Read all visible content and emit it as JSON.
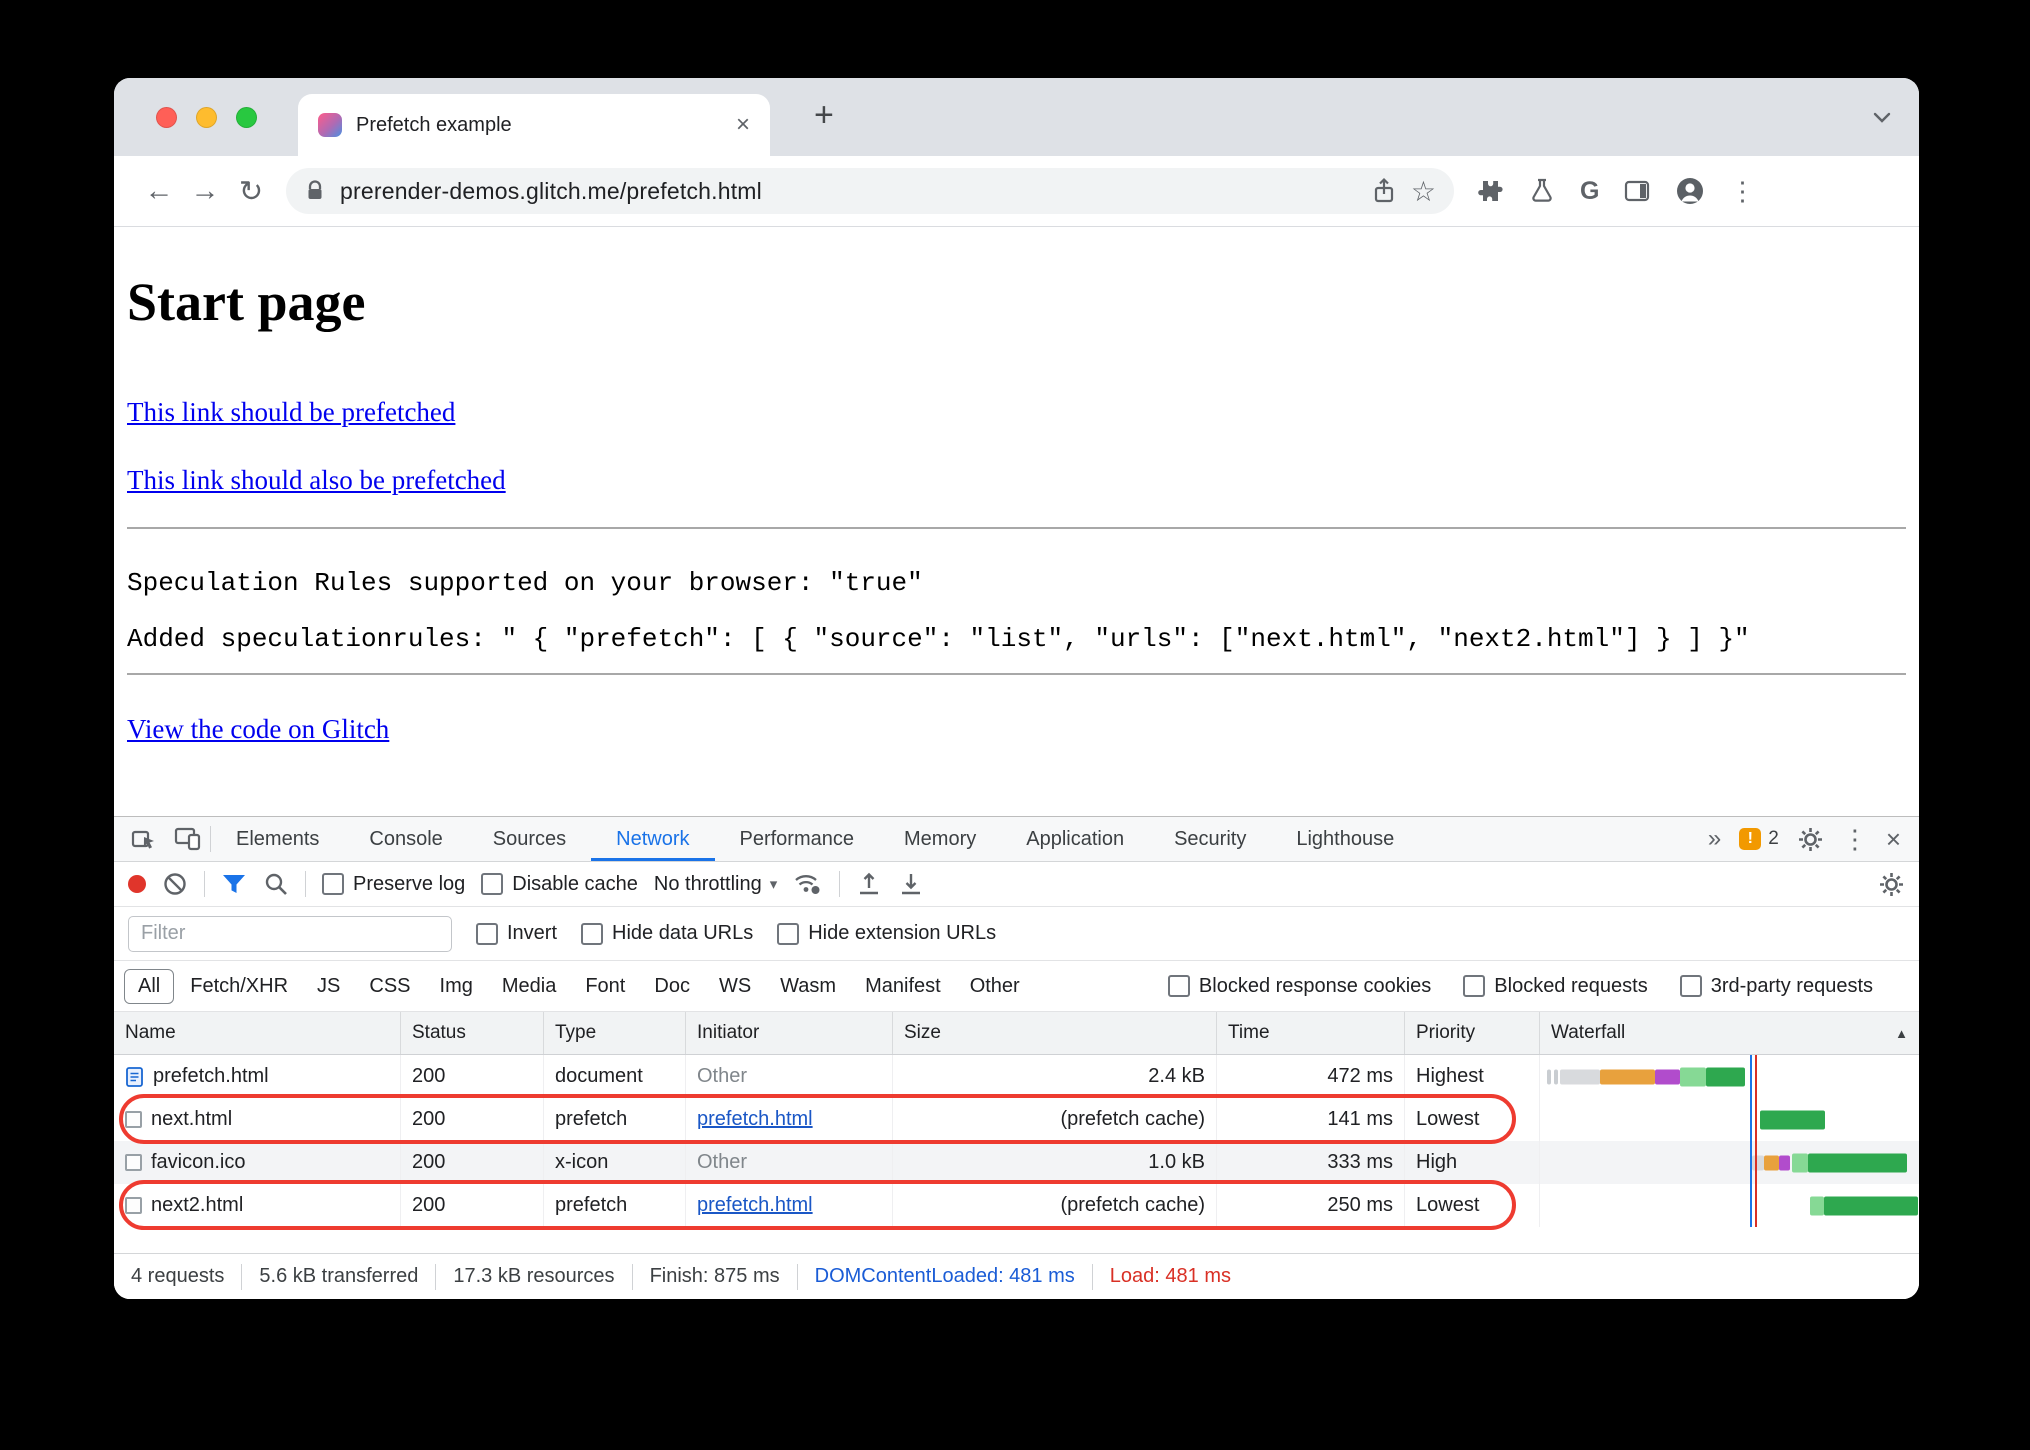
{
  "browser": {
    "tab_title": "Prefetch example",
    "url": "prerender-demos.glitch.me/prefetch.html"
  },
  "glyphs": {
    "close": "×",
    "plus": "+",
    "back": "←",
    "forward": "→",
    "reload": "↻",
    "star": "☆",
    "kebab": "⋮",
    "g_logo": "G",
    "more_tabs": "»",
    "caret": "▾",
    "sort_asc": "▲",
    "warn": "!"
  },
  "page": {
    "heading": "Start page",
    "link1": "This link should be prefetched",
    "link2": "This link should also be prefetched",
    "mono1": "Speculation Rules supported on your browser: \"true\"",
    "mono2": "Added speculationrules: \" { \"prefetch\": [ { \"source\": \"list\", \"urls\": [\"next.html\", \"next2.html\"] } ] }\"",
    "link3": "View the code on Glitch"
  },
  "devtools": {
    "tabs": [
      "Elements",
      "Console",
      "Sources",
      "Network",
      "Performance",
      "Memory",
      "Application",
      "Security",
      "Lighthouse"
    ],
    "badge_count": "2",
    "toolbar": {
      "preserve_log": "Preserve log",
      "disable_cache": "Disable cache",
      "throttling": "No throttling"
    },
    "filter": {
      "placeholder": "Filter",
      "invert": "Invert",
      "hide_data_urls": "Hide data URLs",
      "hide_extension_urls": "Hide extension URLs"
    },
    "chips": [
      "All",
      "Fetch/XHR",
      "JS",
      "CSS",
      "Img",
      "Media",
      "Font",
      "Doc",
      "WS",
      "Wasm",
      "Manifest",
      "Other"
    ],
    "filter_checkboxes": [
      "Blocked response cookies",
      "Blocked requests",
      "3rd-party requests"
    ],
    "columns": [
      "Name",
      "Status",
      "Type",
      "Initiator",
      "Size",
      "Time",
      "Priority",
      "Waterfall"
    ],
    "rows": [
      {
        "name": "prefetch.html",
        "status": "200",
        "type": "document",
        "initiator": "Other",
        "size": "2.4 kB",
        "time": "472 ms",
        "priority": "Highest"
      },
      {
        "name": "next.html",
        "status": "200",
        "type": "prefetch",
        "initiator": "prefetch.html",
        "size": "(prefetch cache)",
        "time": "141 ms",
        "priority": "Lowest"
      },
      {
        "name": "favicon.ico",
        "status": "200",
        "type": "x-icon",
        "initiator": "Other",
        "size": "1.0 kB",
        "time": "333 ms",
        "priority": "High"
      },
      {
        "name": "next2.html",
        "status": "200",
        "type": "prefetch",
        "initiator": "prefetch.html",
        "size": "(prefetch cache)",
        "time": "250 ms",
        "priority": "Lowest"
      }
    ],
    "summary": {
      "requests": "4 requests",
      "transferred": "5.6 kB transferred",
      "resources": "17.3 kB resources",
      "finish": "Finish: 875 ms",
      "dcl": "DOMContentLoaded: 481 ms",
      "load": "Load: 481 ms"
    }
  },
  "colors": {
    "highlight_red": "#ee3b30",
    "active_tab_blue": "#1a73e8",
    "link_blue": "#0000ee",
    "waterfall_green": "#2ea84f",
    "dcl_line_blue": "#1a73e8",
    "load_line_red": "#d93025"
  }
}
